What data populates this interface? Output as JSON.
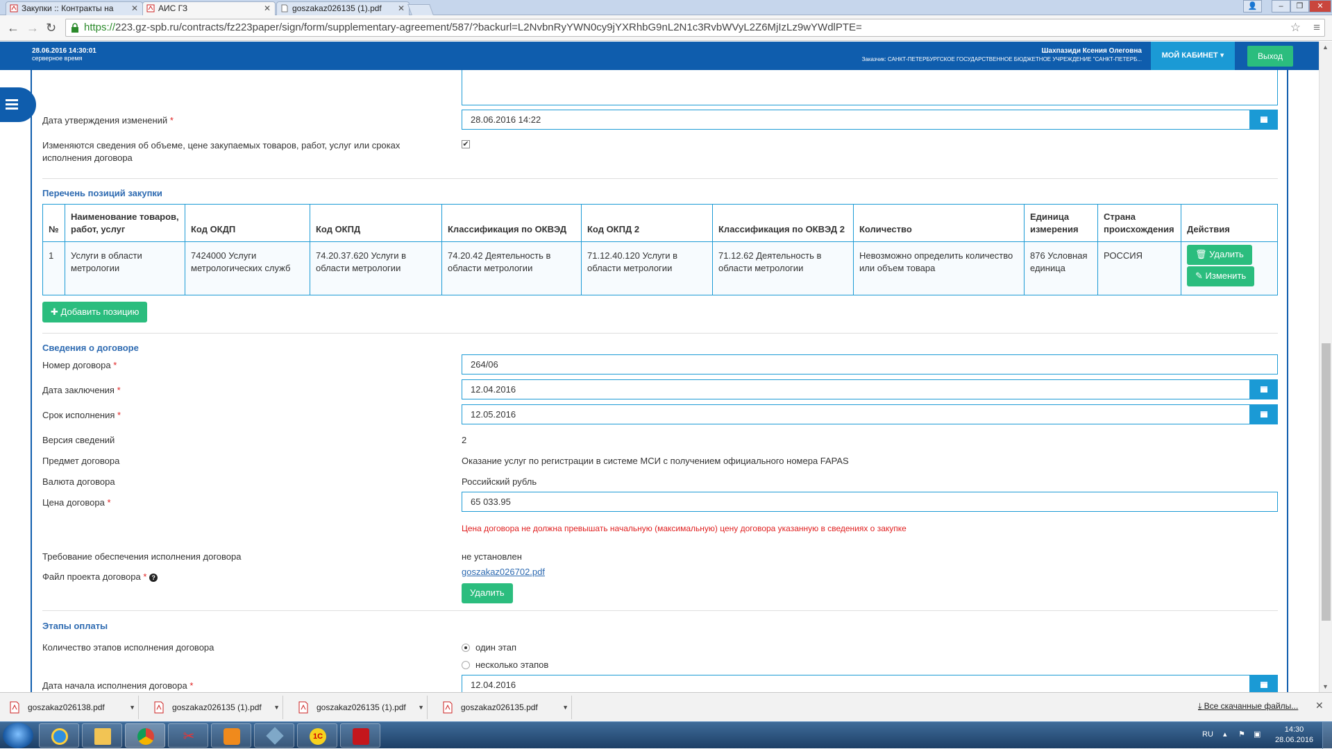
{
  "browser": {
    "tabs": [
      {
        "label": "Закупки :: Контракты на"
      },
      {
        "label": "АИС ГЗ"
      },
      {
        "label": "goszakaz026135 (1).pdf"
      }
    ],
    "url_scheme": "https://",
    "url_rest": "223.gz-spb.ru/contracts/fz223paper/sign/form/supplementary-agreement/587/?backurl=L2NvbnRyYWN0cy9jYXRhbG9nL2N1c3RvbWVyL2Z6MjIzLz9wYWdlPTE="
  },
  "header": {
    "datetime": "28.06.2016 14:30:01",
    "datetime_note": "серверное время",
    "user_name": "Шахпазиди Ксения Олеговна",
    "customer": "Заказчик: САНКТ-ПЕТЕРБУРГСКОЕ ГОСУДАРСТВЕННОЕ БЮДЖЕТНОЕ УЧРЕЖДЕНИЕ \"САНКТ-ПЕТЕРБ...",
    "cabinet_label": "МОЙ КАБИНЕТ",
    "logout_label": "Выход"
  },
  "form": {
    "approval_date_label": "Дата утверждения изменений",
    "approval_date_value": "28.06.2016 14:22",
    "changes_label_1": "Изменяются сведения об объеме, цене закупаемых товаров, работ, услуг или сроках",
    "changes_label_2": "исполнения договора",
    "changes_checked": true,
    "positions_title": "Перечень позиций закупки",
    "table": {
      "headers": [
        "№",
        "Наименование товаров, работ, услуг",
        "Код ОКДП",
        "Код ОКПД",
        "Классификация по ОКВЭД",
        "Код ОКПД 2",
        "Классификация по ОКВЭД 2",
        "Количество",
        "Единица измерения",
        "Страна происхождения",
        "Действия"
      ],
      "rows": [
        [
          "1",
          "Услуги в области метрологии",
          "7424000 Услуги метрологических служб",
          "74.20.37.620 Услуги в области метрологии",
          "74.20.42 Деятельность в области метрологии",
          "71.12.40.120 Услуги в области метрологии",
          "71.12.62 Деятельность в области метрологии",
          "Невозможно определить количество или объем товара",
          "876 Условная единица",
          "РОССИЯ"
        ]
      ],
      "delete_label": "Удалить",
      "edit_label": "Изменить"
    },
    "add_position_label": "Добавить позицию",
    "contract_title": "Сведения о договоре",
    "contract_number_label": "Номер договора",
    "contract_number_value": "264/06",
    "conclusion_date_label": "Дата заключения",
    "conclusion_date_value": "12.04.2016",
    "execution_term_label": "Срок исполнения",
    "execution_term_value": "12.05.2016",
    "version_label": "Версия сведений",
    "version_value": "2",
    "subject_label": "Предмет договора",
    "subject_value": "Оказание услуг по регистрации в системе МСИ с получением официального номера FAPAS",
    "currency_label": "Валюта договора",
    "currency_value": "Российский рубль",
    "price_label": "Цена договора",
    "price_value": "65 033.95",
    "price_error": "Цена договора не должна превышать начальную (максимальную) цену договора указанную в сведениях о закупке",
    "security_label": "Требование обеспечения исполнения договора",
    "security_value": "не установлен",
    "file_label": "Файл проекта договора",
    "file_link": "goszakaz026702.pdf",
    "file_delete_label": "Удалить",
    "payment_title": "Этапы оплаты",
    "stages_label": "Количество этапов исполнения договора",
    "stage_option_1": "один этап",
    "stage_option_2": "несколько этапов",
    "start_date_label": "Дата начала исполнения договора",
    "start_date_value": "12.04.2016"
  },
  "downloads": {
    "items": [
      "goszakaz026138.pdf",
      "goszakaz026135 (1).pdf",
      "goszakaz026135 (1).pdf",
      "goszakaz026135.pdf"
    ],
    "all_label": "Все скачанные файлы..."
  },
  "taskbar": {
    "lang": "RU",
    "time": "14:30",
    "date": "28.06.2016"
  },
  "colors": {
    "brand_blue": "#0f5dad",
    "accent_blue": "#1b9ad5",
    "green": "#2bbd7e",
    "error_red": "#e02020"
  }
}
